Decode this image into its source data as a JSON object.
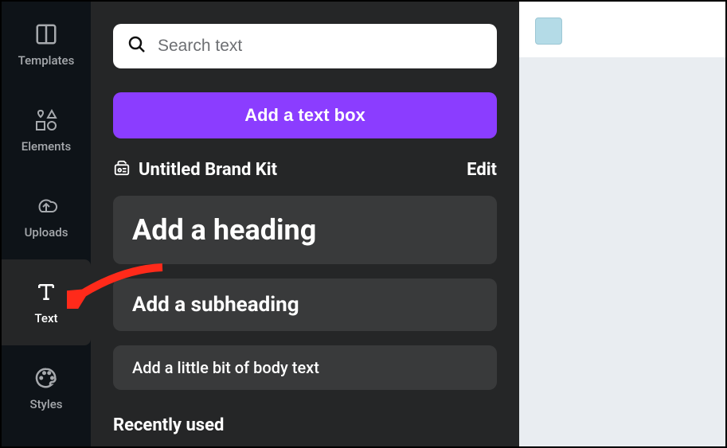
{
  "sidebar": {
    "items": [
      {
        "label": "Templates"
      },
      {
        "label": "Elements"
      },
      {
        "label": "Uploads"
      },
      {
        "label": "Text"
      },
      {
        "label": "Styles"
      }
    ]
  },
  "panel": {
    "search_placeholder": "Search text",
    "primary_button": "Add a text box",
    "brand_kit": {
      "name": "Untitled Brand Kit",
      "edit_label": "Edit"
    },
    "text_presets": {
      "heading": "Add a heading",
      "subheading": "Add a subheading",
      "body": "Add a little bit of body text"
    },
    "recently_used_label": "Recently used",
    "collapse_glyph": "‹"
  },
  "canvas": {
    "swatch_color": "#b4dbe7"
  }
}
